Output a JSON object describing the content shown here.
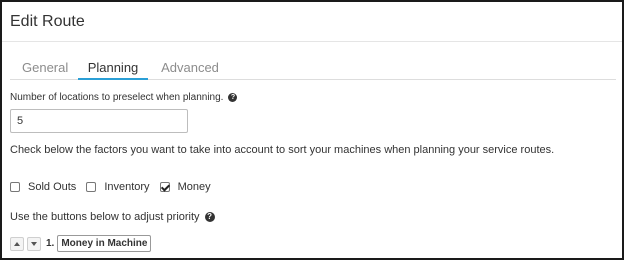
{
  "header": {
    "title": "Edit Route"
  },
  "tabs": [
    {
      "label": "General"
    },
    {
      "label": "Planning"
    },
    {
      "label": "Advanced"
    }
  ],
  "planning": {
    "preselect_label": "Number of locations to preselect when planning.",
    "preselect_value": "5",
    "factors_text": "Check below the factors you want to take into account to sort your machines when planning your service routes.",
    "factors": [
      {
        "label": "Sold Outs",
        "checked": false
      },
      {
        "label": "Inventory",
        "checked": false
      },
      {
        "label": "Money",
        "checked": true
      }
    ],
    "priority_text": "Use the buttons below to adjust priority",
    "priority_items": [
      {
        "index": "1.",
        "label": "Money in Machine"
      }
    ]
  },
  "icons": {
    "help": "question-circle-icon",
    "up": "triangle-up-icon",
    "down": "triangle-down-icon"
  },
  "colors": {
    "accent": "#2a9fd6",
    "text": "#333333",
    "muted": "#8c8c8c"
  }
}
